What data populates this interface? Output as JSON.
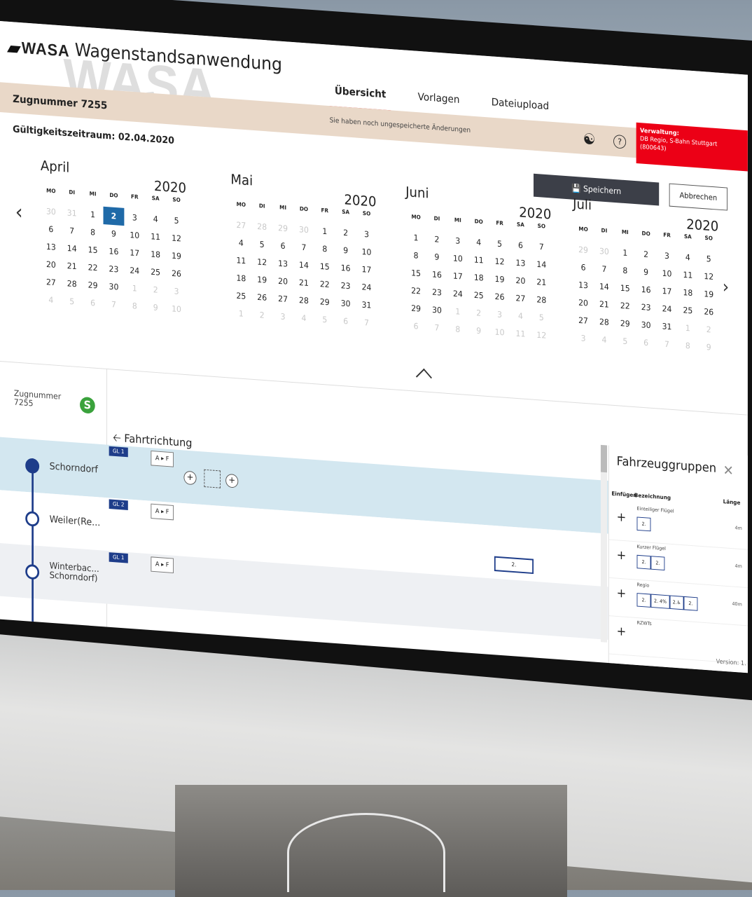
{
  "app": {
    "logo": "WASA",
    "title": "Wagenstandsanwendung"
  },
  "tabs": [
    {
      "label": "Übersicht",
      "active": true
    },
    {
      "label": "Vorlagen",
      "active": false
    },
    {
      "label": "Dateiupload",
      "active": false
    }
  ],
  "header": {
    "train_number": "Zugnummer 7255",
    "unsaved_notice": "Sie haben noch ungespeicherte Änderungen",
    "admin_title": "Verwaltung:",
    "admin_org": "DB Regio, S-Bahn Stuttgart",
    "admin_id": "(800643)"
  },
  "validity": "Gültigkeitszeitraum: 02.04.2020",
  "actions": {
    "save_label": "Speichern",
    "cancel_label": "Abbrechen"
  },
  "weekdays": [
    "MO",
    "DI",
    "MI",
    "DO",
    "FR",
    "SA",
    "SO"
  ],
  "months": [
    {
      "name": "April",
      "year": "2020",
      "days": [
        "30",
        "31",
        "1",
        "2",
        "3",
        "4",
        "5",
        "6",
        "7",
        "8",
        "9",
        "10",
        "11",
        "12",
        "13",
        "14",
        "15",
        "16",
        "17",
        "18",
        "19",
        "20",
        "21",
        "22",
        "23",
        "24",
        "25",
        "26",
        "27",
        "28",
        "29",
        "30",
        "1",
        "2",
        "3",
        "4",
        "5",
        "6",
        "7",
        "8",
        "9",
        "10"
      ],
      "outside": [
        0,
        1,
        32,
        33,
        34,
        35,
        36,
        37,
        38,
        39,
        40,
        41
      ],
      "selected": 3
    },
    {
      "name": "Mai",
      "year": "2020",
      "days": [
        "27",
        "28",
        "29",
        "30",
        "1",
        "2",
        "3",
        "4",
        "5",
        "6",
        "7",
        "8",
        "9",
        "10",
        "11",
        "12",
        "13",
        "14",
        "15",
        "16",
        "17",
        "18",
        "19",
        "20",
        "21",
        "22",
        "23",
        "24",
        "25",
        "26",
        "27",
        "28",
        "29",
        "30",
        "31",
        "1",
        "2",
        "3",
        "4",
        "5",
        "6",
        "7"
      ],
      "outside": [
        0,
        1,
        2,
        3,
        35,
        36,
        37,
        38,
        39,
        40,
        41
      ],
      "selected": -1
    },
    {
      "name": "Juni",
      "year": "2020",
      "days": [
        "1",
        "2",
        "3",
        "4",
        "5",
        "6",
        "7",
        "8",
        "9",
        "10",
        "11",
        "12",
        "13",
        "14",
        "15",
        "16",
        "17",
        "18",
        "19",
        "20",
        "21",
        "22",
        "23",
        "24",
        "25",
        "26",
        "27",
        "28",
        "29",
        "30",
        "1",
        "2",
        "3",
        "4",
        "5",
        "6",
        "7",
        "8",
        "9",
        "10",
        "11",
        "12"
      ],
      "outside": [
        30,
        31,
        32,
        33,
        34,
        35,
        36,
        37,
        38,
        39,
        40,
        41
      ],
      "selected": -1
    },
    {
      "name": "Juli",
      "year": "2020",
      "days": [
        "29",
        "30",
        "1",
        "2",
        "3",
        "4",
        "5",
        "6",
        "7",
        "8",
        "9",
        "10",
        "11",
        "12",
        "13",
        "14",
        "15",
        "16",
        "17",
        "18",
        "19",
        "20",
        "21",
        "22",
        "23",
        "24",
        "25",
        "26",
        "27",
        "28",
        "29",
        "30",
        "31",
        "1",
        "2",
        "3",
        "4",
        "5",
        "6",
        "7",
        "8",
        "9"
      ],
      "outside": [
        0,
        1,
        33,
        34,
        35,
        36,
        37,
        38,
        39,
        40,
        41
      ],
      "selected": -1
    }
  ],
  "train_panel": {
    "label_line1": "Zugnummer",
    "label_line2": "7255",
    "line_badge": "S",
    "direction": "Fahrtrichtung"
  },
  "stations": [
    {
      "name": "Schorndorf",
      "track": "GL 1",
      "orientation": "A ▸ F"
    },
    {
      "name": "Weiler(Re...",
      "track": "GL 2",
      "orientation": "A ▸ F"
    },
    {
      "name": "Winterbac... Schorndorf)",
      "track": "GL 1",
      "orientation": "A ▸ F"
    }
  ],
  "wagon_label": "2.",
  "vehicle_groups": {
    "title": "Fahrzeuggruppen",
    "col_insert": "Einfügen",
    "col_name": "Bezeichnung",
    "col_length": "Länge",
    "items": [
      {
        "name": "Einteiliger Flügel",
        "length": "4m",
        "cars": [
          "2."
        ]
      },
      {
        "name": "Kurzer Flügel",
        "length": "4m",
        "cars": [
          "2.",
          "2."
        ]
      },
      {
        "name": "Regio",
        "length": "40m",
        "cars": [
          "2.",
          "2. 4%",
          "2.♿",
          "2."
        ]
      },
      {
        "name": "RZWTs",
        "length": "",
        "cars": []
      }
    ]
  },
  "version": "Version: 1.",
  "colors": {
    "accent_red": "#e30613",
    "selected_blue": "#1f6aa8",
    "track_blue": "#1e3d8a",
    "banner": "#e9d8c8"
  }
}
